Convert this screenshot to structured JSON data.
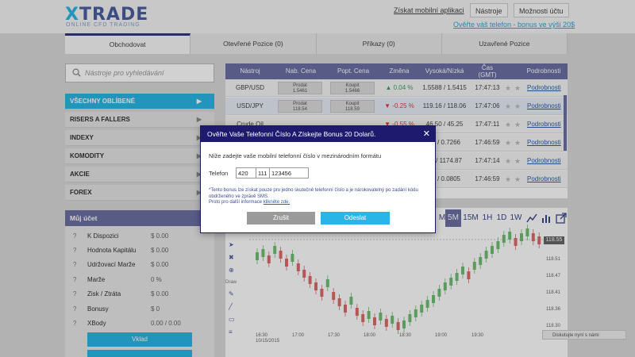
{
  "header": {
    "logo_main": "TRADE",
    "logo_x": "X",
    "logo_sub": "ONLINE CFD TRADING",
    "mobile_app_link": "Získat mobilní aplikaci",
    "tools_button": "Nástroje",
    "account_options_button": "Možnosti účtu",
    "promo_link": "Ověřte váš telefon - bonus ve výši 20$"
  },
  "tabs": [
    {
      "label": "Obchodovat"
    },
    {
      "label": "Otevřené Pozice (0)"
    },
    {
      "label": "Příkazy (0)"
    },
    {
      "label": "Uzavřené Pozice"
    }
  ],
  "search": {
    "placeholder": "Nástroje pro vyhledávání"
  },
  "categories": [
    {
      "label": "VŠECHNY OBLÍBENÉ"
    },
    {
      "label": "RISERS A FALLERS"
    },
    {
      "label": "INDEXY"
    },
    {
      "label": "KOMODITY"
    },
    {
      "label": "AKCIE"
    },
    {
      "label": "FOREX"
    }
  ],
  "account": {
    "title": "Můj účet",
    "rows": [
      {
        "label": "K Dispozici",
        "value": "$ 0.00"
      },
      {
        "label": "Hodnota Kapitálu",
        "value": "$ 0.00"
      },
      {
        "label": "Udržovací Marže",
        "value": "$ 0.00"
      },
      {
        "label": "Marže",
        "value": "0 %"
      },
      {
        "label": "Zisk / Ztráta",
        "value": "$ 0.00"
      },
      {
        "label": "Bonusy",
        "value": "$ 0"
      },
      {
        "label": "XBody",
        "value": "0.00 / 0.00"
      }
    ],
    "deposit_button": "Vklad"
  },
  "market": {
    "headers": {
      "instrument": "Nástroj",
      "buy": "Nab. Cena",
      "sell": "Popt. Cena",
      "change": "Změna",
      "highlow": "Vysoká/Nízká",
      "time_line1": "Čas",
      "time_line2": "(GMT)",
      "details": "Podrobnosti"
    },
    "rows": [
      {
        "name": "GBP/USD",
        "buy_label": "Prodat",
        "buy": "1.5461",
        "sell_label": "Koupit",
        "sell": "1.5466",
        "change": "0.04 %",
        "dir": "up",
        "highlow": "1.5588 / 1.5415",
        "time": "17:47:13",
        "details": "Podrobnosti"
      },
      {
        "name": "USD/JPY",
        "buy_label": "Prodat",
        "buy": "118.54",
        "sell_label": "Koupit",
        "sell": "118.59",
        "change": "-0.25 %",
        "dir": "down",
        "highlow": "119.16 / 118.06",
        "time": "17:47:06",
        "details": "Podrobnosti"
      },
      {
        "name": "Crude Oil",
        "buy_label": "",
        "buy": "",
        "sell_label": "",
        "sell": "",
        "change": "-0.55 %",
        "dir": "down",
        "highlow": "46.50 / 45.25",
        "time": "17:47:11",
        "details": "Podrobnosti"
      },
      {
        "name": "",
        "buy_label": "",
        "buy": "",
        "sell_label": "",
        "sell": "",
        "change": "",
        "dir": "",
        "highlow": "53 / 0.7266",
        "time": "17:46:59",
        "details": "Podrobnosti"
      },
      {
        "name": "",
        "buy_label": "",
        "buy": "",
        "sell_label": "",
        "sell": "",
        "change": "",
        "dir": "",
        "highlow": "53 / 1174.87",
        "time": "17:47:14",
        "details": "Podrobnosti"
      },
      {
        "name": "",
        "buy_label": "",
        "buy": "",
        "sell_label": "",
        "sell": "",
        "change": "",
        "dir": "",
        "highlow": "20 / 0.0805",
        "time": "17:46:59",
        "details": "Podrobnosti"
      }
    ]
  },
  "chart": {
    "timeframes": [
      "M",
      "5M",
      "15M",
      "1H",
      "1D",
      "1W"
    ],
    "active_timeframe": "5M",
    "draw_label": "Draw",
    "last_price": "118.55",
    "y_ticks": [
      "118.51",
      "118.47",
      "118.41",
      "118.36",
      "118.30"
    ],
    "x_ticks": [
      "16:30",
      "17:00",
      "17:30",
      "18:00",
      "18:30",
      "19:00",
      "19:30"
    ],
    "date_label": "10/15/2015",
    "discuss_label": "Diskutujte nyní s námi",
    "candle_up_color": "#6fbf73",
    "candle_down_color": "#e06a6a"
  },
  "modal": {
    "title": "Ověřte Vaše Telefonní Číslo A Získejte Bonus 20 Dolarů.",
    "description": "Níže zadejte vaše mobilní telefonní číslo v mezinárodním formátu",
    "phone_label": "Telefon",
    "phone_country": "420",
    "phone_prefix": "111",
    "phone_number": "123456",
    "note_line1": "*Tento bonus lze získat pouze pro jedno skutečné telefonní číslo a je nárokovatelný po zadání kódu obdrženého ve zprávě SMS.",
    "note_line2": "Proto pro další informace",
    "note_link": "klikněte zde.",
    "cancel_button": "Zrušit",
    "send_button": "Odeslat"
  }
}
